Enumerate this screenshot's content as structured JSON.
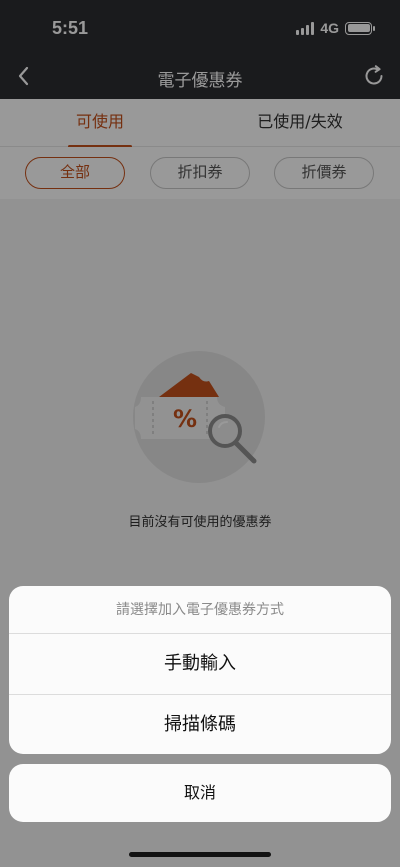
{
  "status_bar": {
    "time": "5:51",
    "network": "4G"
  },
  "nav": {
    "title": "電子優惠券",
    "back_icon": "chevron-left-icon",
    "refresh_icon": "refresh-icon"
  },
  "tabs": [
    {
      "label": "可使用",
      "active": true
    },
    {
      "label": "已使用/失效",
      "active": false
    }
  ],
  "filters": [
    {
      "label": "全部",
      "active": true
    },
    {
      "label": "折扣券",
      "active": false
    },
    {
      "label": "折價券",
      "active": false
    }
  ],
  "empty_state": {
    "icon": "coupon-search-icon",
    "message": "目前沒有可使用的優惠券"
  },
  "action_sheet": {
    "title": "請選擇加入電子優惠券方式",
    "options": [
      {
        "label": "手動輸入"
      },
      {
        "label": "掃描條碼"
      }
    ],
    "cancel_label": "取消"
  },
  "colors": {
    "accent": "#c4501c",
    "header_bg": "#2c2d31",
    "content_bg": "#f3f3f3"
  }
}
